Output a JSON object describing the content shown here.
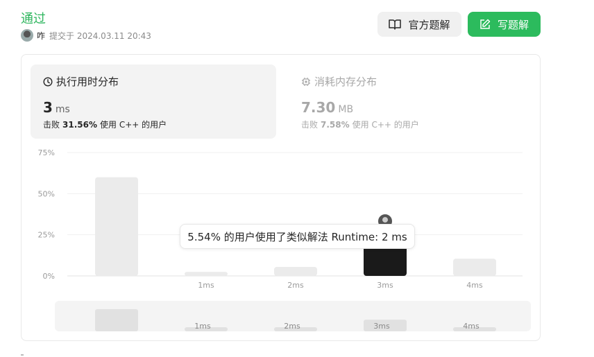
{
  "header": {
    "status": "通过",
    "username": "咋",
    "submitted": "提交于 2024.03.11 20:43",
    "official_solution_label": "官方题解",
    "write_solution_label": "写题解"
  },
  "runtime_panel": {
    "title": "执行用时分布",
    "value": "3",
    "unit": "ms",
    "beat_prefix": "击败",
    "beat_percent": "31.56%",
    "beat_suffix": "使用 C++ 的用户"
  },
  "memory_panel": {
    "title": "消耗内存分布",
    "value": "7.30",
    "unit": "MB",
    "beat_prefix": "击败",
    "beat_percent": "7.58%",
    "beat_suffix": "使用 C++ 的用户"
  },
  "tooltip": "5.54% 的用户使用了类似解法 Runtime: 2 ms",
  "colors": {
    "accent": "#2cbb5d",
    "selected_bar": "#1a1a1a",
    "bar": "#ebebeb"
  },
  "chart_data": {
    "type": "bar",
    "categories": [
      "",
      "1ms",
      "2ms",
      "3ms",
      "4ms"
    ],
    "values": [
      60,
      2.5,
      5.5,
      31.56,
      10.5
    ],
    "selected_index": 3,
    "ylim": [
      0,
      75
    ],
    "yticks": [
      "0%",
      "25%",
      "50%",
      "75%"
    ],
    "ytick_values": [
      0,
      25,
      50,
      75
    ],
    "minimap_labels": [
      "",
      "1ms",
      "2ms",
      "3ms",
      "4ms"
    ]
  }
}
